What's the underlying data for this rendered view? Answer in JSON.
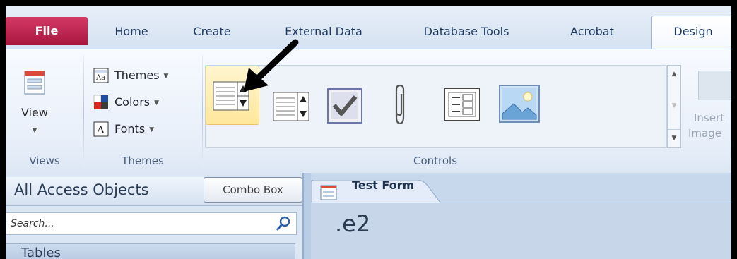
{
  "tabs": {
    "file": "File",
    "home": "Home",
    "create": "Create",
    "external_data": "External Data",
    "database_tools": "Database Tools",
    "acrobat": "Acrobat",
    "design": "Design"
  },
  "ribbon": {
    "views_group": {
      "button_label": "View",
      "group_label": "Views"
    },
    "themes_group": {
      "themes": "Themes",
      "colors": "Colors",
      "fonts": "Fonts",
      "group_label": "Themes"
    },
    "controls_group": {
      "group_label": "Controls",
      "insert_image_line1": "Insert",
      "insert_image_line2": "Image"
    }
  },
  "tooltip": "Combo Box",
  "nav_pane": {
    "title": "All Access Objects",
    "search_placeholder": "Search...",
    "tables_header": "Tables"
  },
  "document": {
    "tab_label": "Test Form",
    "form_text": ".e2"
  },
  "colors": {
    "file_tab": "#b41a46",
    "ribbon_bg": "#e9f0fa",
    "highlight": "#ffe79a",
    "nav_bg": "#dbe6f4"
  }
}
